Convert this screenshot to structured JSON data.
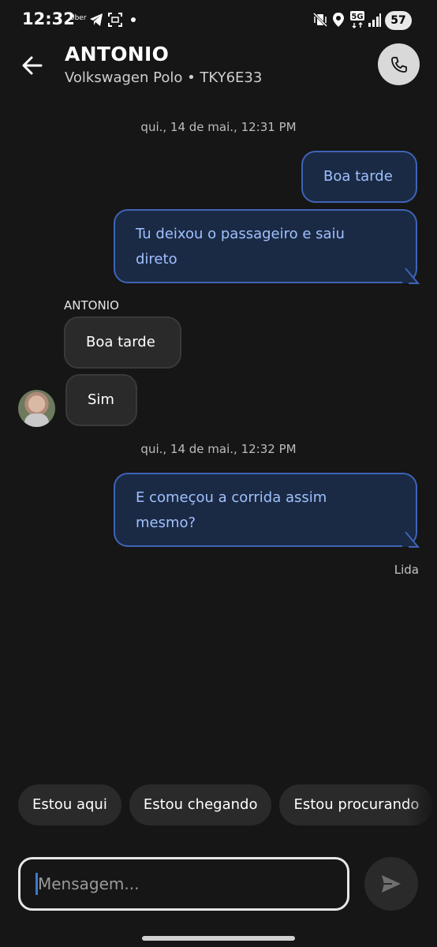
{
  "status_bar": {
    "time": "12:32",
    "app_label": "Uber",
    "network": "5G",
    "battery": "57",
    "icons": [
      "uber-icon",
      "telegram-icon",
      "screenshot-icon",
      "notification-dot-icon",
      "vibrate-mute-icon",
      "location-icon",
      "5g-icon",
      "signal-icon",
      "battery-icon"
    ]
  },
  "header": {
    "name": "ANTONIO",
    "vehicle": "Volkswagen Polo • TKY6E33",
    "back_icon": "arrow-left-icon",
    "call_icon": "phone-icon"
  },
  "chat": {
    "timestamp_1": "qui., 14 de mai., 12:31 PM",
    "out_1": "Boa tarde",
    "out_2_line1": "Tu deixou o passageiro e saiu",
    "out_2_line2": "direto",
    "sender": "ANTONIO",
    "in_1": "Boa tarde",
    "in_2": "Sim",
    "timestamp_2": "qui., 14 de mai., 12:32 PM",
    "out_3_line1": "E começou a corrida assim",
    "out_3_line2": "mesmo?",
    "read_status": "Lida"
  },
  "quick_replies": [
    "Estou aqui",
    "Estou chegando",
    "Estou procurando"
  ],
  "composer": {
    "placeholder": "Mensagem...",
    "send_icon": "send-icon"
  },
  "colors": {
    "background": "#161616",
    "outgoing_bubble": "#1b2a44",
    "outgoing_border": "#3e63b8",
    "outgoing_text": "#9fc0ff",
    "incoming_bubble": "#2a2a2a"
  }
}
